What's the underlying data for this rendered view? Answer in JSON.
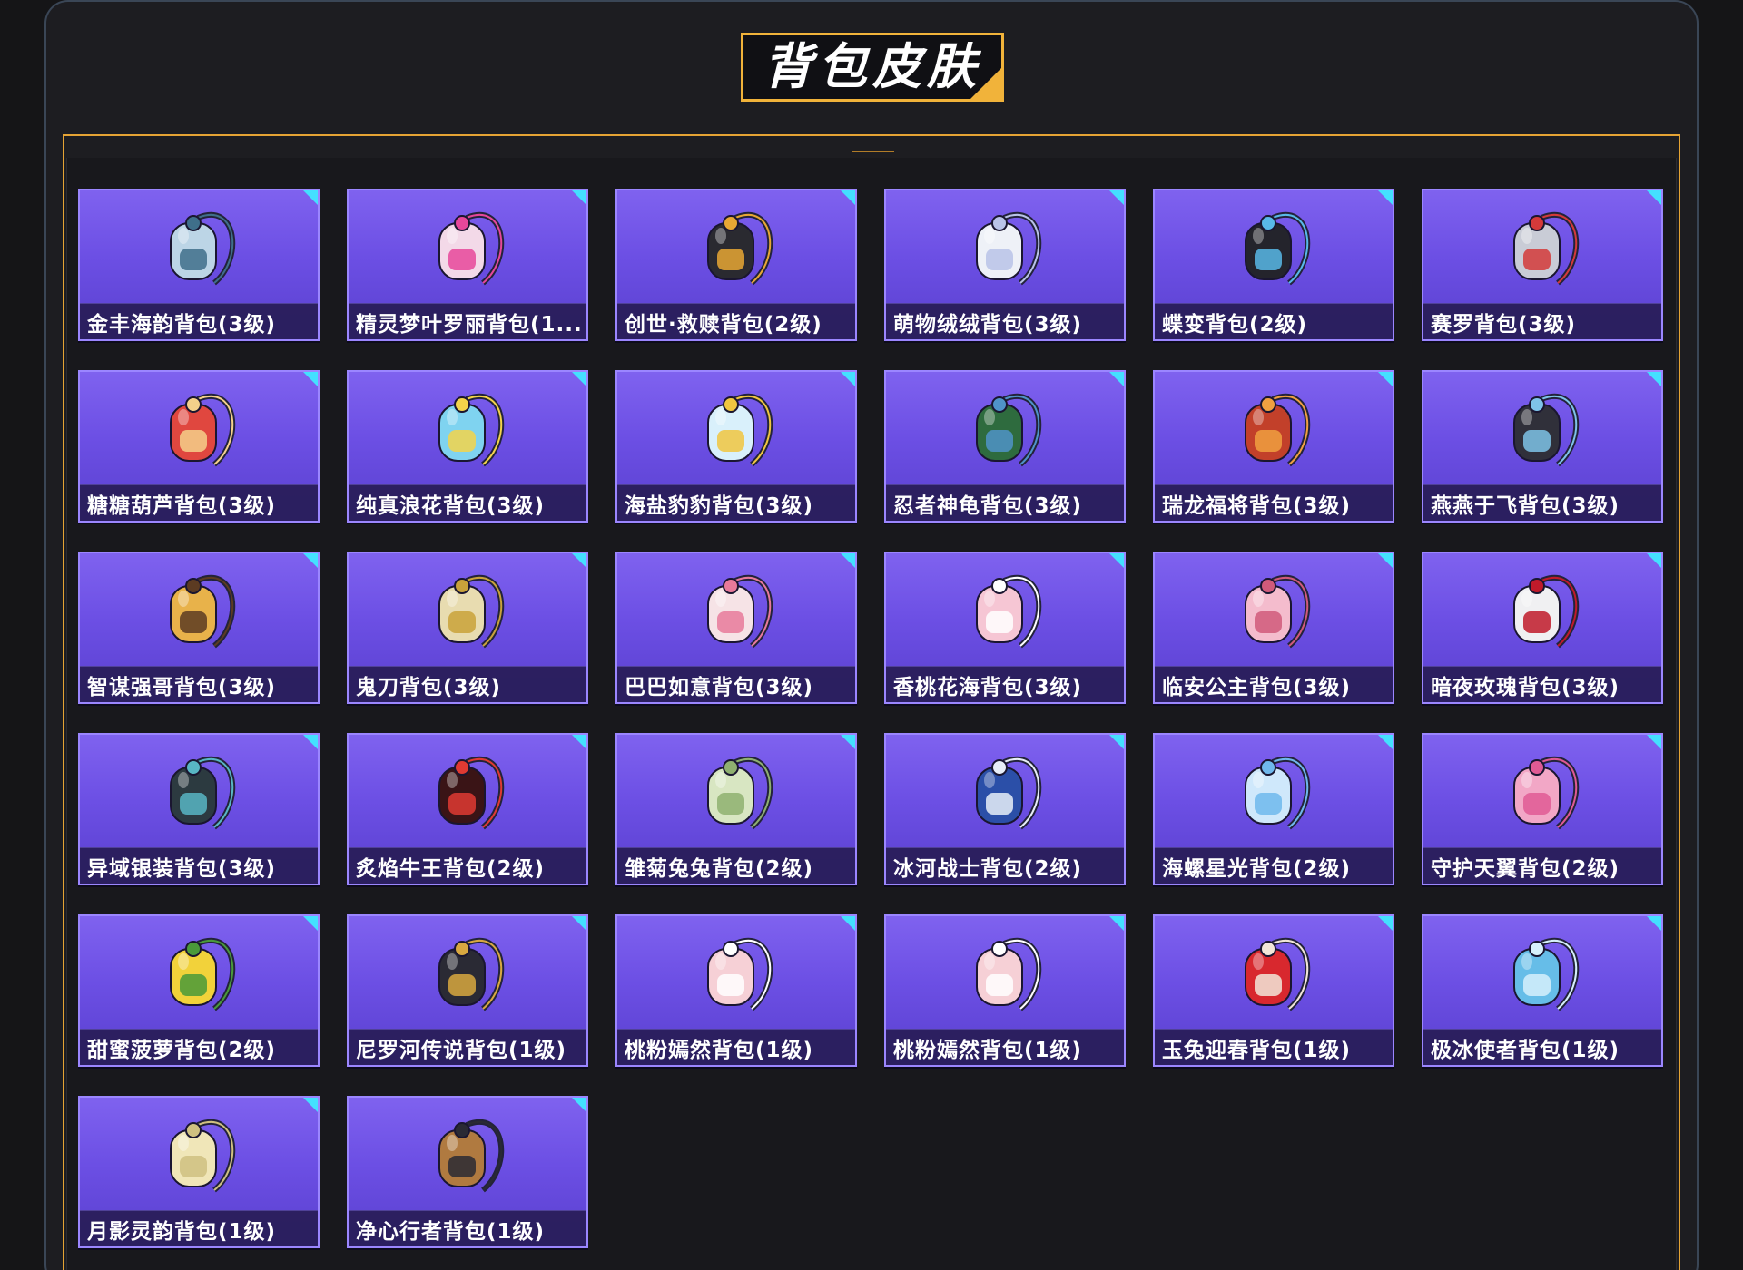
{
  "section": {
    "title": "背包皮肤"
  },
  "items": [
    {
      "label": "金丰海韵背包(3级)",
      "icon": "backpack-icon",
      "color": "#bcd5e6",
      "accent": "#3f6f8a"
    },
    {
      "label": "精灵梦叶罗丽背包(1...",
      "icon": "backpack-icon",
      "color": "#f3d9e8",
      "accent": "#e6479a"
    },
    {
      "label": "创世·救赎背包(2级)",
      "icon": "backpack-icon",
      "color": "#2a2a30",
      "accent": "#e7a734"
    },
    {
      "label": "萌物绒绒背包(3级)",
      "icon": "backpack-icon",
      "color": "#eef1f7",
      "accent": "#b9c3e8"
    },
    {
      "label": "蝶变背包(2级)",
      "icon": "backpack-icon",
      "color": "#24242c",
      "accent": "#58b9e8"
    },
    {
      "label": "赛罗背包(3级)",
      "icon": "backpack-icon",
      "color": "#c9ccd6",
      "accent": "#d43a3a"
    },
    {
      "label": "糖糖葫芦背包(3级)",
      "icon": "backpack-icon",
      "color": "#e0473f",
      "accent": "#f4d08a"
    },
    {
      "label": "纯真浪花背包(3级)",
      "icon": "backpack-icon",
      "color": "#7fd3f0",
      "accent": "#f3d34a"
    },
    {
      "label": "海盐豹豹背包(3级)",
      "icon": "backpack-icon",
      "color": "#d9f0fb",
      "accent": "#f0c640"
    },
    {
      "label": "忍者神龟背包(3级)",
      "icon": "backpack-icon",
      "color": "#2e6b3e",
      "accent": "#4f93c8"
    },
    {
      "label": "瑞龙福将背包(3级)",
      "icon": "backpack-icon",
      "color": "#c2402a",
      "accent": "#f0a040"
    },
    {
      "label": "燕燕于飞背包(3级)",
      "icon": "backpack-icon",
      "color": "#30303a",
      "accent": "#7ec3e8"
    },
    {
      "label": "智谋强哥背包(3级)",
      "icon": "backpack-icon",
      "color": "#e8b24a",
      "accent": "#5c3b22"
    },
    {
      "label": "鬼刀背包(3级)",
      "icon": "backpack-icon",
      "color": "#e8dcb0",
      "accent": "#c9a23a"
    },
    {
      "label": "巴巴如意背包(3级)",
      "icon": "backpack-icon",
      "color": "#f6e3e6",
      "accent": "#e87a9a"
    },
    {
      "label": "香桃花海背包(3级)",
      "icon": "backpack-icon",
      "color": "#f6c6d4",
      "accent": "#ffffff"
    },
    {
      "label": "临安公主背包(3级)",
      "icon": "backpack-icon",
      "color": "#f4bccd",
      "accent": "#d05a7a"
    },
    {
      "label": "暗夜玫瑰背包(3级)",
      "icon": "backpack-icon",
      "color": "#f0f0f2",
      "accent": "#c01a2a"
    },
    {
      "label": "异域银装背包(3级)",
      "icon": "backpack-icon",
      "color": "#2c3a40",
      "accent": "#58b6c4"
    },
    {
      "label": "炙焰牛王背包(2级)",
      "icon": "backpack-icon",
      "color": "#3a1416",
      "accent": "#e03a32"
    },
    {
      "label": "雏菊兔兔背包(2级)",
      "icon": "backpack-icon",
      "color": "#d8e6c2",
      "accent": "#8fb070"
    },
    {
      "label": "冰河战士背包(2级)",
      "icon": "backpack-icon",
      "color": "#2b4fa8",
      "accent": "#e8eef8"
    },
    {
      "label": "海螺星光背包(2级)",
      "icon": "backpack-icon",
      "color": "#cfe8fb",
      "accent": "#6fb8ec"
    },
    {
      "label": "守护天翼背包(2级)",
      "icon": "backpack-icon",
      "color": "#f2a7c6",
      "accent": "#e05a94"
    },
    {
      "label": "甜蜜菠萝背包(2级)",
      "icon": "backpack-icon",
      "color": "#f2d23a",
      "accent": "#4a9a3a"
    },
    {
      "label": "尼罗河传说背包(1级)",
      "icon": "backpack-icon",
      "color": "#2a2a34",
      "accent": "#d8a840"
    },
    {
      "label": "桃粉嫣然背包(1级)",
      "icon": "backpack-icon",
      "color": "#f6d0d6",
      "accent": "#ffffff"
    },
    {
      "label": "桃粉嫣然背包(1级)",
      "icon": "backpack-icon",
      "color": "#f6d0d6",
      "accent": "#ffffff"
    },
    {
      "label": "玉兔迎春背包(1级)",
      "icon": "backpack-icon",
      "color": "#d8282e",
      "accent": "#f2e6d8"
    },
    {
      "label": "极冰使者背包(1级)",
      "icon": "backpack-icon",
      "color": "#66bde8",
      "accent": "#d6f0fb"
    },
    {
      "label": "月影灵韵背包(1级)",
      "icon": "backpack-icon",
      "color": "#f0e6b8",
      "accent": "#cfc080"
    },
    {
      "label": "净心行者背包(1级)",
      "icon": "backpack-icon",
      "color": "#b07a40",
      "accent": "#2a2a34"
    }
  ]
}
